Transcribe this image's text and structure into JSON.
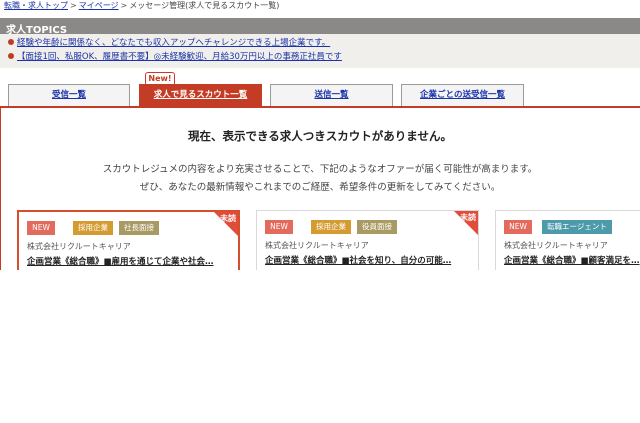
{
  "breadcrumb": {
    "items": [
      "転職・求人トップ",
      "マイページ"
    ],
    "separator": ">",
    "current": "メッセージ管理(求人で見るスカウト一覧)"
  },
  "topics": {
    "title": "求人TOPICS",
    "items": [
      "経験や年齢に関係なく、どなたでも収入アップへチャレンジできる上場企業です。",
      "【面接1回、私服OK、履歴書不要】◎未経験歓迎、月給30万円以上の事務正社員です"
    ]
  },
  "tabs": [
    {
      "label": "受信一覧",
      "active": false
    },
    {
      "label": "求人で見るスカウト一覧",
      "active": true
    },
    {
      "label": "送信一覧",
      "active": false
    },
    {
      "label": "企業ごとの送受信一覧",
      "active": false
    }
  ],
  "new_badge": "New!",
  "message": {
    "title": "現在、表示できる求人つきスカウトがありません。",
    "line1": "スカウトレジュメの内容をより充実させることで、下記のようなオファーが届く可能性が高まります。",
    "line2": "ぜひ、あなたの最新情報やこれまでのご経歴、希望条件の更新をしてみてください。"
  },
  "cards": [
    {
      "new": "NEW",
      "tags": [
        "採用企業",
        "社長面接"
      ],
      "unread": "未読",
      "company": "株式会社リクルートキャリア",
      "title": "企画営業《総合職》■雇用を通じて企業や社会…"
    },
    {
      "new": "NEW",
      "tags": [
        "採用企業",
        "役員面接"
      ],
      "unread": "未読",
      "company": "株式会社リクルートキャリア",
      "title": "企画営業《総合職》■社会を知り、自分の可能…"
    },
    {
      "new": "NEW",
      "tags": [
        "転職エージェント"
      ],
      "unread": "",
      "company": "株式会社リクルートキャリア",
      "title": "企画営業《総合職》■顧客満足を…"
    }
  ],
  "colors": {
    "accent": "#c43c25",
    "topics_bar": "#8b8988",
    "link": "#1a33a8"
  }
}
